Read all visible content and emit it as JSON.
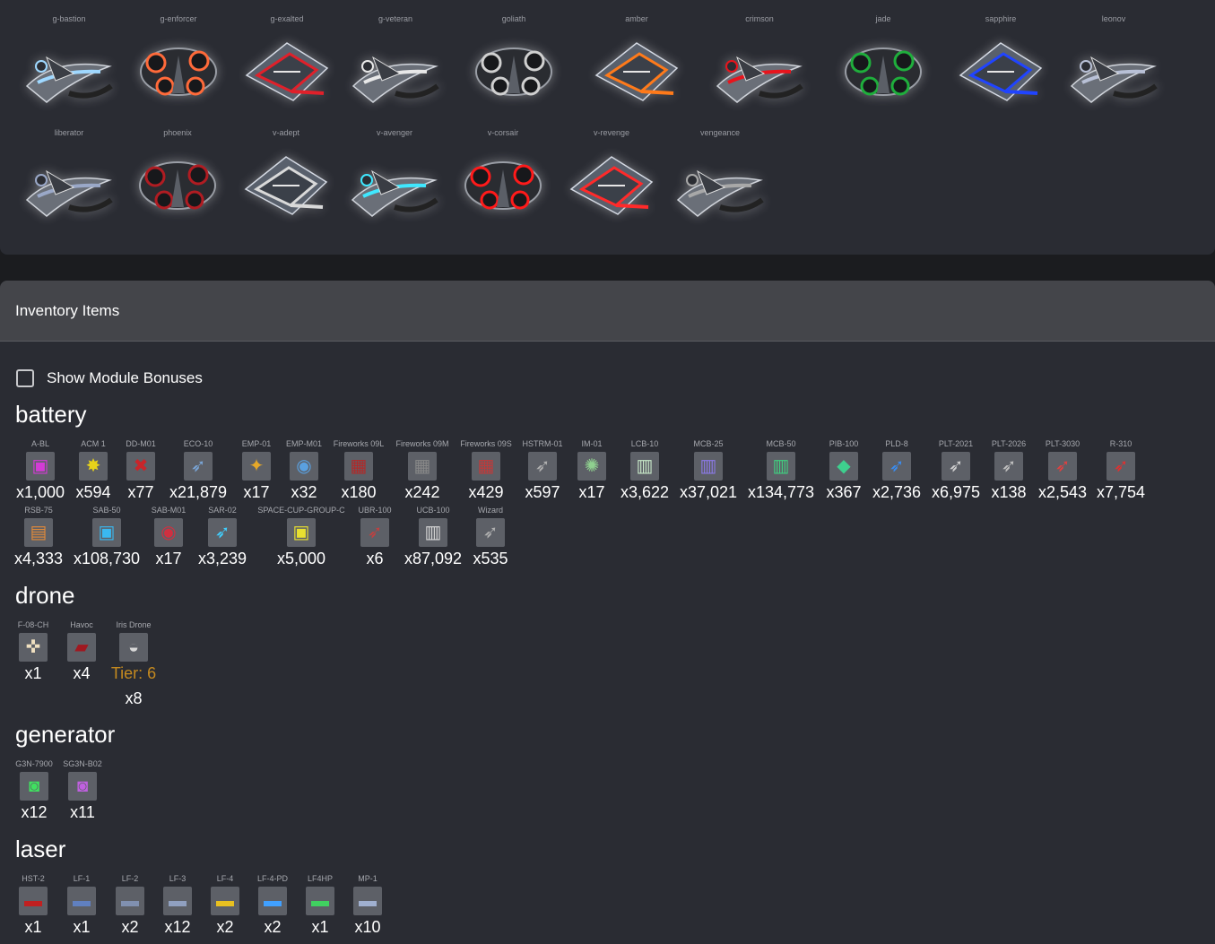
{
  "ships": {
    "row1": [
      {
        "label": "g-bastion",
        "icon": "ship-g-bastion-icon",
        "color": "#9fd8ff"
      },
      {
        "label": "g-enforcer",
        "icon": "ship-g-enforcer-icon",
        "color": "#ff6a3a"
      },
      {
        "label": "g-exalted",
        "icon": "ship-g-exalted-icon",
        "color": "#e0202a"
      },
      {
        "label": "g-veteran",
        "icon": "ship-g-veteran-icon",
        "color": "#e8e8e8"
      },
      {
        "label": "goliath",
        "icon": "ship-goliath-icon",
        "color": "#d0d0d0"
      },
      {
        "label": "amber",
        "icon": "ship-amber-icon",
        "color": "#ff7a1a"
      },
      {
        "label": "crimson",
        "icon": "ship-crimson-icon",
        "color": "#e8141c"
      },
      {
        "label": "jade",
        "icon": "ship-jade-icon",
        "color": "#1fae3c"
      },
      {
        "label": "sapphire",
        "icon": "ship-sapphire-icon",
        "color": "#2044ff"
      },
      {
        "label": "leonov",
        "icon": "ship-leonov-icon",
        "color": "#b8c0d6"
      }
    ],
    "row2": [
      {
        "label": "liberator",
        "icon": "ship-liberator-icon",
        "color": "#9aa8c8"
      },
      {
        "label": "phoenix",
        "icon": "ship-phoenix-icon",
        "color": "#b01c22"
      },
      {
        "label": "v-adept",
        "icon": "ship-v-adept-icon",
        "color": "#d9d9d9"
      },
      {
        "label": "v-avenger",
        "icon": "ship-v-avenger-icon",
        "color": "#3fe8ff"
      },
      {
        "label": "v-corsair",
        "icon": "ship-v-corsair-icon",
        "color": "#ff1a1a"
      },
      {
        "label": "v-revenge",
        "icon": "ship-v-revenge-icon",
        "color": "#ff2a2a"
      },
      {
        "label": "vengeance",
        "icon": "ship-vengeance-icon",
        "color": "#a8a8a8"
      }
    ]
  },
  "inventory": {
    "title": "Inventory Items",
    "bonus_label": "Show Module Bonuses",
    "categories": {
      "battery": {
        "title": "battery",
        "row1": [
          {
            "name": "A-BL",
            "qty": "x1,000",
            "icon": "a-bl-icon",
            "glyph": "▣",
            "color": "#d43bd6"
          },
          {
            "name": "ACM 1",
            "qty": "x594",
            "icon": "acm-1-icon",
            "glyph": "✸",
            "color": "#e6d21a"
          },
          {
            "name": "DD-M01",
            "qty": "x77",
            "icon": "dd-m01-icon",
            "glyph": "✖",
            "color": "#c9252a"
          },
          {
            "name": "ECO-10",
            "qty": "x21,879",
            "icon": "eco-10-icon",
            "glyph": "➶",
            "color": "#7aa6d8"
          },
          {
            "name": "EMP-01",
            "qty": "x17",
            "icon": "emp-01-icon",
            "glyph": "✦",
            "color": "#e5a829"
          },
          {
            "name": "EMP-M01",
            "qty": "x32",
            "icon": "emp-m01-icon",
            "glyph": "◉",
            "color": "#5aa0e0"
          },
          {
            "name": "Fireworks 09L",
            "qty": "x180",
            "icon": "fireworks-09l-icon",
            "glyph": "▦",
            "color": "#b02a2a"
          },
          {
            "name": "Fireworks 09M",
            "qty": "x242",
            "icon": "fireworks-09m-icon",
            "glyph": "▦",
            "color": "#888"
          },
          {
            "name": "Fireworks 09S",
            "qty": "x429",
            "icon": "fireworks-09s-icon",
            "glyph": "▦",
            "color": "#c03a3a"
          },
          {
            "name": "HSTRM-01",
            "qty": "x597",
            "icon": "hstrm-01-icon",
            "glyph": "➶",
            "color": "#b0b0b0"
          },
          {
            "name": "IM-01",
            "qty": "x17",
            "icon": "im-01-icon",
            "glyph": "✺",
            "color": "#8fd08f"
          },
          {
            "name": "LCB-10",
            "qty": "x3,622",
            "icon": "lcb-10-icon",
            "glyph": "▥",
            "color": "#c8e8c8"
          },
          {
            "name": "MCB-25",
            "qty": "x37,021",
            "icon": "mcb-25-icon",
            "glyph": "▥",
            "color": "#8c7ae8"
          },
          {
            "name": "MCB-50",
            "qty": "x134,773",
            "icon": "mcb-50-icon",
            "glyph": "▥",
            "color": "#40d080"
          },
          {
            "name": "PIB-100",
            "qty": "x367",
            "icon": "pib-100-icon",
            "glyph": "◆",
            "color": "#3ecf8e"
          },
          {
            "name": "PLD-8",
            "qty": "x2,736",
            "icon": "pld-8-icon",
            "glyph": "➶",
            "color": "#3a8cf0"
          },
          {
            "name": "PLT-2021",
            "qty": "x6,975",
            "icon": "plt-2021-icon",
            "glyph": "➶",
            "color": "#d0d0d0"
          },
          {
            "name": "PLT-2026",
            "qty": "x138",
            "icon": "plt-2026-icon",
            "glyph": "➶",
            "color": "#c0c0c0"
          },
          {
            "name": "PLT-3030",
            "qty": "x2,543",
            "icon": "plt-3030-icon",
            "glyph": "➶",
            "color": "#e04040"
          },
          {
            "name": "R-310",
            "qty": "x7,754",
            "icon": "r-310-icon",
            "glyph": "➶",
            "color": "#e03030"
          }
        ],
        "row2": [
          {
            "name": "RSB-75",
            "qty": "x4,333",
            "icon": "rsb-75-icon",
            "glyph": "▤",
            "color": "#e08a3a"
          },
          {
            "name": "SAB-50",
            "qty": "x108,730",
            "icon": "sab-50-icon",
            "glyph": "▣",
            "color": "#3ab8f0"
          },
          {
            "name": "SAB-M01",
            "qty": "x17",
            "icon": "sab-m01-icon",
            "glyph": "◉",
            "color": "#d03040"
          },
          {
            "name": "SAR-02",
            "qty": "x3,239",
            "icon": "sar-02-icon",
            "glyph": "➶",
            "color": "#40d0ff"
          },
          {
            "name": "SPACE-CUP-GROUP-C",
            "qty": "x5,000",
            "icon": "space-cup-group-c-icon",
            "glyph": "▣",
            "color": "#e8e030"
          },
          {
            "name": "UBR-100",
            "qty": "x6",
            "icon": "ubr-100-icon",
            "glyph": "➶",
            "color": "#c04040"
          },
          {
            "name": "UCB-100",
            "qty": "x87,092",
            "icon": "ucb-100-icon",
            "glyph": "▥",
            "color": "#d8d8d8"
          },
          {
            "name": "Wizard",
            "qty": "x535",
            "icon": "wizard-icon",
            "glyph": "➶",
            "color": "#b0b0b0"
          }
        ]
      },
      "drone": {
        "title": "drone",
        "items": [
          {
            "name": "F-08-CH",
            "qty": "x1",
            "icon": "f-08-ch-icon",
            "glyph": "✜",
            "color": "#f0e0c0"
          },
          {
            "name": "Havoc",
            "qty": "x4",
            "icon": "havoc-icon",
            "glyph": "▰",
            "color": "#a01820"
          },
          {
            "name": "Iris Drone",
            "qty": "x8",
            "tier": "Tier: 6",
            "icon": "iris-drone-icon",
            "glyph": "◒",
            "color": "#d8d8d8"
          }
        ]
      },
      "generator": {
        "title": "generator",
        "items": [
          {
            "name": "G3N-7900",
            "qty": "x12",
            "icon": "g3n-7900-icon",
            "glyph": "◙",
            "color": "#40e060"
          },
          {
            "name": "SG3N-B02",
            "qty": "x11",
            "icon": "sg3n-b02-icon",
            "glyph": "◙",
            "color": "#c060e0"
          }
        ]
      },
      "laser": {
        "title": "laser",
        "items": [
          {
            "name": "HST-2",
            "qty": "x1",
            "icon": "hst-2-icon",
            "glyph": "▬",
            "color": "#c02020"
          },
          {
            "name": "LF-1",
            "qty": "x1",
            "icon": "lf-1-icon",
            "glyph": "▬",
            "color": "#6080c0"
          },
          {
            "name": "LF-2",
            "qty": "x2",
            "icon": "lf-2-icon",
            "glyph": "▬",
            "color": "#8090b0"
          },
          {
            "name": "LF-3",
            "qty": "x12",
            "icon": "lf-3-icon",
            "glyph": "▬",
            "color": "#90a0c0"
          },
          {
            "name": "LF-4",
            "qty": "x2",
            "icon": "lf-4-icon",
            "glyph": "▬",
            "color": "#e8c020"
          },
          {
            "name": "LF-4-PD",
            "qty": "x2",
            "icon": "lf-4-pd-icon",
            "glyph": "▬",
            "color": "#40a0ff"
          },
          {
            "name": "LF4HP",
            "qty": "x1",
            "icon": "lf4hp-icon",
            "glyph": "▬",
            "color": "#40d060"
          },
          {
            "name": "MP-1",
            "qty": "x10",
            "icon": "mp-1-icon",
            "glyph": "▬",
            "color": "#a0b0d0"
          }
        ]
      }
    }
  }
}
